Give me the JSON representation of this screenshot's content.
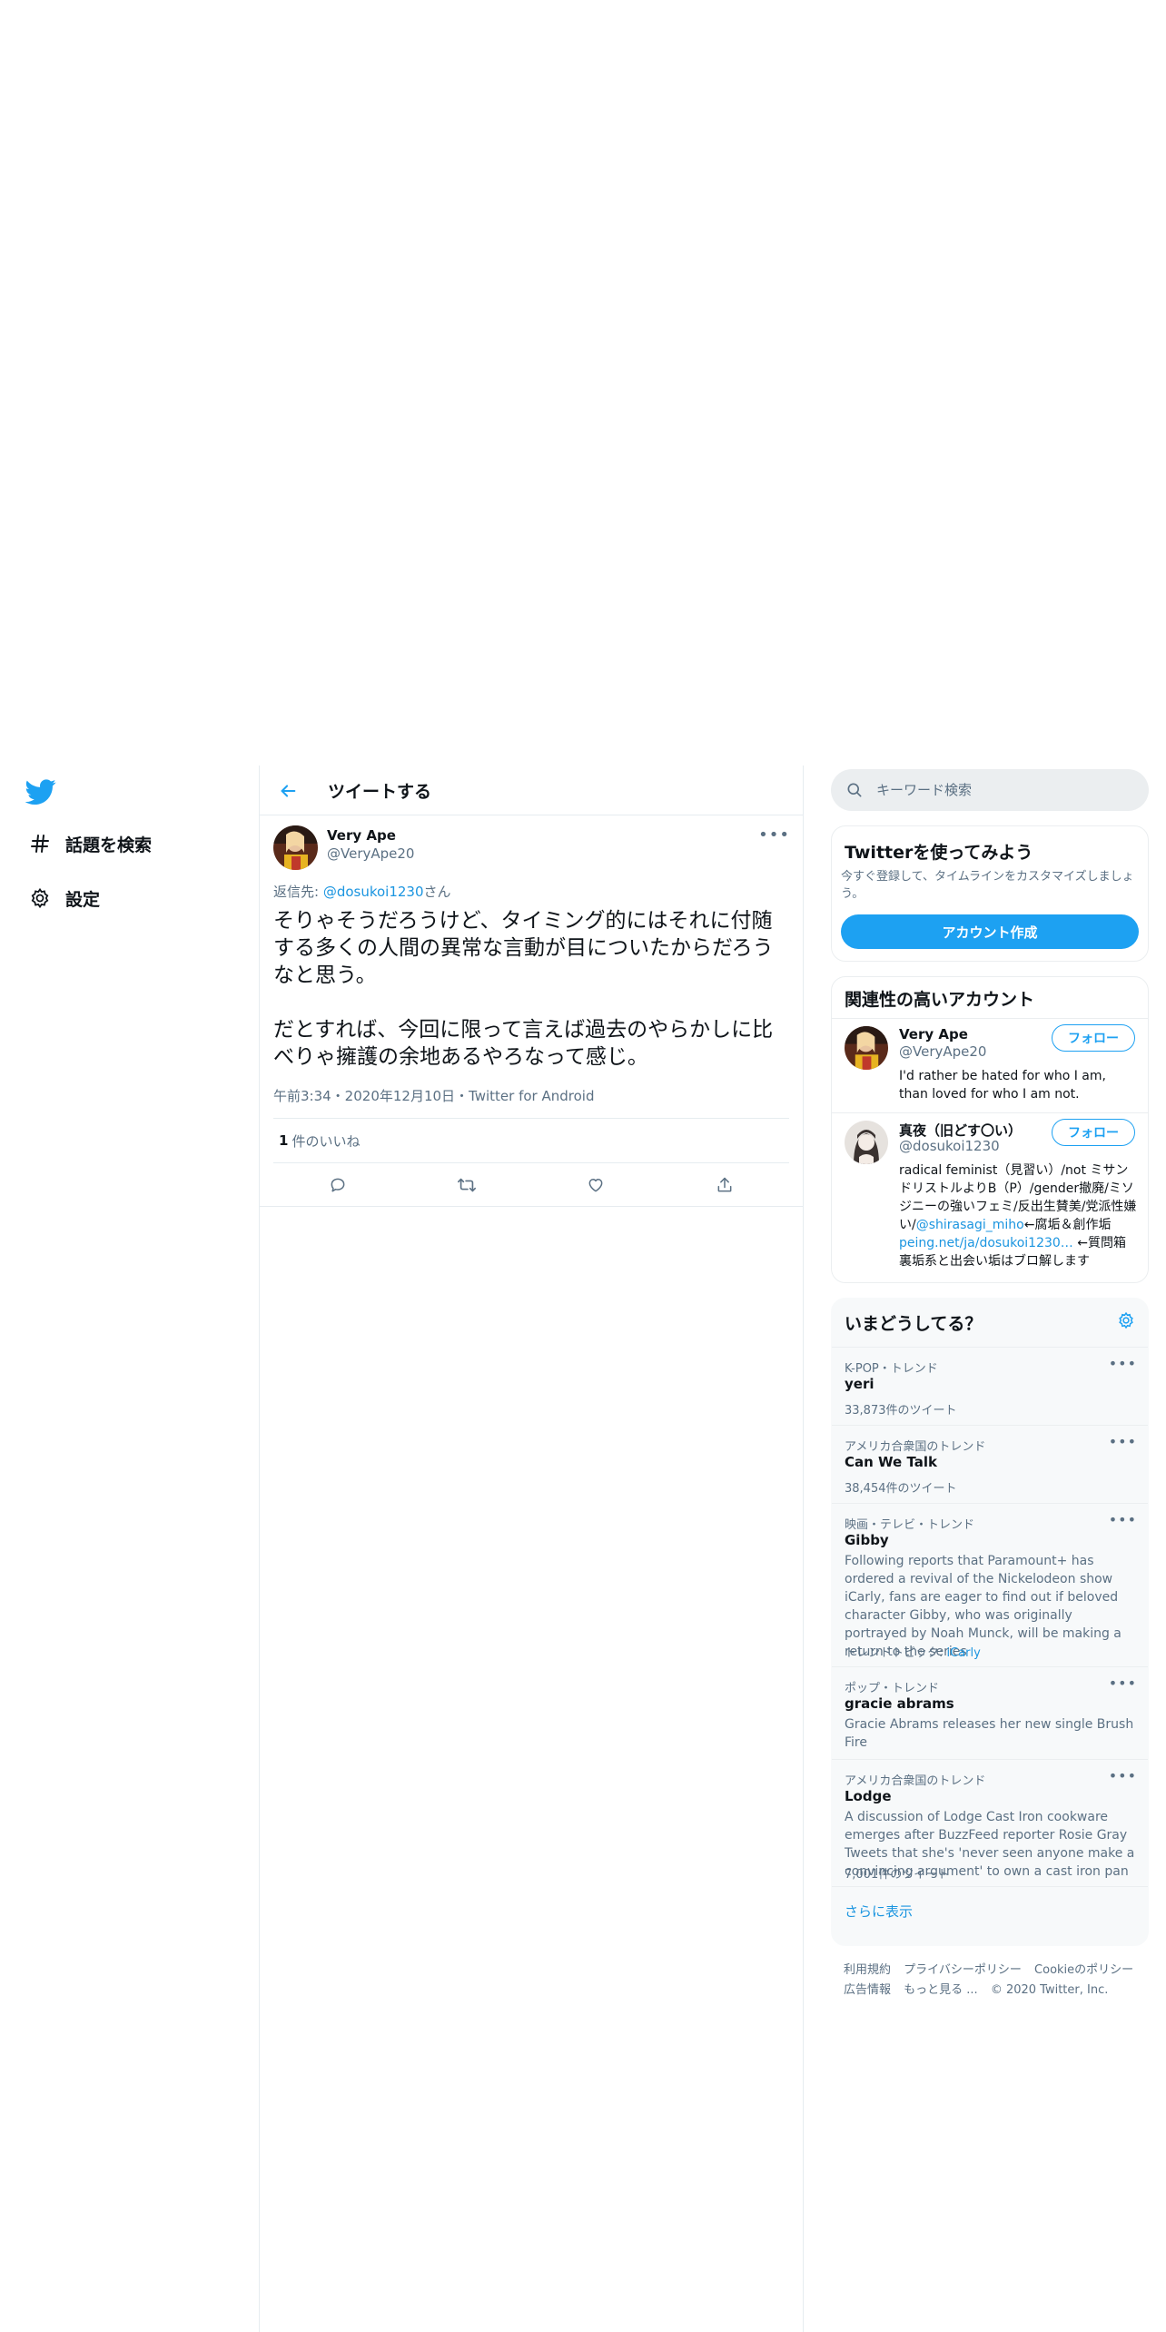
{
  "nav": {
    "items": [
      {
        "label": "話題を検索",
        "icon": "hashtag-icon"
      },
      {
        "label": "設定",
        "icon": "gear-icon"
      }
    ]
  },
  "header": {
    "title": "ツイートする"
  },
  "tweet": {
    "author_name": "Very Ape",
    "author_handle": "@VeryApe20",
    "reply_prefix": "返信先: ",
    "reply_to": "@dosukoi1230",
    "reply_suffix": "さん",
    "body": "そりゃそうだろうけど、タイミング的にはそれに付随する多くの人間の異常な言動が目についたからだろうなと思う。\n\nだとすれば、今回に限って言えば過去のやらかしに比べりゃ擁護の余地あるやろなって感じ。",
    "meta": "午前3:34・2020年12月10日・Twitter for Android",
    "like_count": "1",
    "like_label": "件のいいね"
  },
  "search": {
    "placeholder": "キーワード検索"
  },
  "signup": {
    "title": "Twitterを使ってみよう",
    "desc": "今すぐ登録して、タイムラインをカスタマイズしましょう。",
    "button": "アカウント作成"
  },
  "related": {
    "title": "関連性の高いアカウント",
    "accounts": [
      {
        "name": "Very Ape",
        "handle": "@VeryApe20",
        "follow": "フォロー",
        "bio": "I'd rather be hated for who I am, than loved for who I am not."
      },
      {
        "name": "真夜（旧どす〇い）",
        "handle": "@dosukoi1230",
        "follow": "フォロー",
        "bio_part1": "radical feminist（見習い）/not ミサンドリストルよりB（P）/gender撤廃/ミソジニーの強いフェミ/反出生賛美/党派性嫌い/",
        "bio_link1": "@shirasagi_miho",
        "bio_part2": "←腐垢＆創作垢 ",
        "bio_link2": "peing.net/ja/dosukoi1230…",
        "bio_part3": " ←質問箱 裏垢系と出会い垢はブロ解します"
      }
    ]
  },
  "trends": {
    "title": "いまどうしてる？",
    "items": [
      {
        "context": "K-POP・トレンド",
        "name": "yeri",
        "count": "33,873件のツイート"
      },
      {
        "context": "アメリカ合衆国のトレンド",
        "name": "Can We Talk",
        "count": "38,454件のツイート"
      },
      {
        "context": "映画・テレビ・トレンド",
        "name": "Gibby",
        "desc": "Following reports that Paramount+ has ordered a revival of the Nickelodeon show iCarly, fans are eager to find out if beloved character Gibby, who was originally portrayed by Noah Munck, will be making a return to the series",
        "topic_label": "トレンドトピック: ",
        "topic": "iCarly"
      },
      {
        "context": "ポップ・トレンド",
        "name": "gracie abrams",
        "desc": "Gracie Abrams releases her new single Brush Fire"
      },
      {
        "context": "アメリカ合衆国のトレンド",
        "name": "Lodge",
        "desc": "A discussion of Lodge Cast Iron cookware emerges after BuzzFeed reporter Rosie Gray Tweets that she's 'never seen anyone make a convincing argument' to own a cast iron pan",
        "count": "7,001件のツイート"
      }
    ],
    "show_more": "さらに表示"
  },
  "footer": {
    "links": [
      "利用規約",
      "プライバシーポリシー",
      "Cookieのポリシー",
      "広告情報",
      "もっと見る ..."
    ],
    "copyright": "© 2020 Twitter, Inc."
  },
  "colors": {
    "accent": "#1da1f2",
    "link": "#1b95e0",
    "muted": "#5b7083",
    "border": "#e6ecf0"
  }
}
